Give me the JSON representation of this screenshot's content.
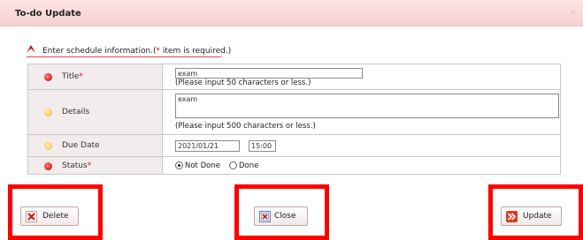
{
  "dialog": {
    "title": "To-do Update",
    "close_glyph": "×"
  },
  "instructions": {
    "text": "Enter schedule information.(",
    "required_mark": "*",
    "text_end": " item is required.)"
  },
  "form": {
    "title": {
      "label": "Title",
      "required_mark": "*",
      "value": "exam",
      "hint": "(Please input 50 characters or less.)"
    },
    "details": {
      "label": "Details",
      "value": "exam",
      "hint": "(Please input 500 characters or less.)"
    },
    "due_date": {
      "label": "Due Date",
      "date_value": "2021/01/21",
      "time_value": "15:00"
    },
    "status": {
      "label": "Status",
      "required_mark": "*",
      "options": [
        {
          "label": "Not Done",
          "selected": true
        },
        {
          "label": "Done",
          "selected": false
        }
      ]
    }
  },
  "buttons": {
    "delete": "Delete",
    "close": "Close",
    "update": "Update"
  },
  "colors": {
    "header_bg": "#f6d2d2",
    "highlight": "#ff0000",
    "required": "#d01010"
  }
}
